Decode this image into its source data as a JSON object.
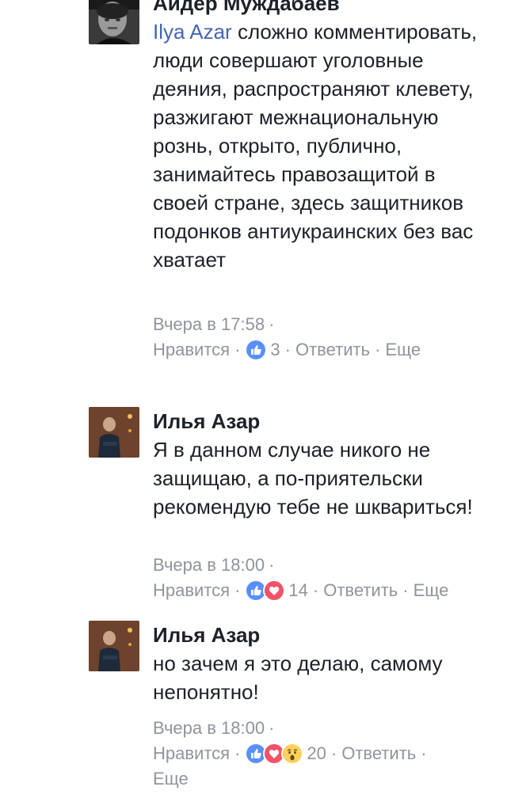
{
  "comments": [
    {
      "author": "Айдер Муждабаев",
      "mention": "Ilya Azar",
      "text": " сложно комментировать, люди совершают уголовные деяния, распространяют клевету, разжигают межнациональную рознь, открыто, публично, занимайтесь правозащитой в своей стране, здесь защитников подонков антиукраинских без вас хватает",
      "time": "Вчера в 17:58",
      "like_label": "Нравится",
      "reactions": [
        "like"
      ],
      "reaction_count": "3",
      "reply_label": "Ответить",
      "more_label": "Еще"
    },
    {
      "author": "Илья Азар",
      "text": "Я в данном случае никого не защищаю, а по-приятельски рекомендую тебе не шквариться!",
      "time": "Вчера в 18:00",
      "like_label": "Нравится",
      "reactions": [
        "like",
        "love"
      ],
      "reaction_count": "14",
      "reply_label": "Ответить",
      "more_label": "Еще"
    },
    {
      "author": "Илья Азар",
      "text": "но зачем я это делаю, самому непонятно!",
      "time": "Вчера в 18:00",
      "like_label": "Нравится",
      "reactions": [
        "like",
        "love",
        "wow"
      ],
      "reaction_count": "20",
      "reply_label": "Ответить",
      "more_label": "Еще"
    }
  ],
  "separator": "·",
  "colors": {
    "text": "#1d2129",
    "meta": "#90949c",
    "link": "#4267b2",
    "like": "#5890ff",
    "love": "#f25268",
    "wow": "#fcd15b"
  }
}
